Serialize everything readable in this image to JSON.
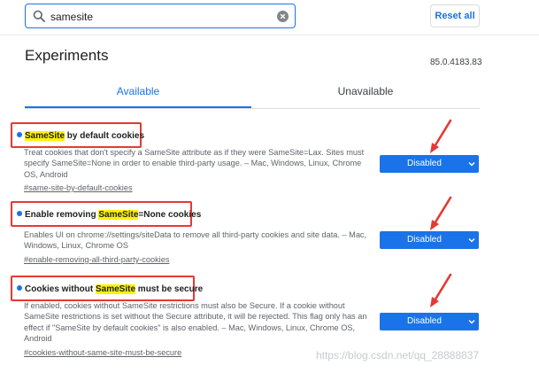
{
  "search": {
    "value": "samesite"
  },
  "reset_label": "Reset all",
  "page_title": "Experiments",
  "version": "85.0.4183.83",
  "tabs": [
    {
      "label": "Available"
    },
    {
      "label": "Unavailable"
    }
  ],
  "experiments": [
    {
      "title_before": "",
      "highlight": "SameSite",
      "title_after": " by default cookies",
      "desc": "Treat cookies that don't specify a SameSite attribute as if they were SameSite=Lax. Sites must specify SameSite=None in order to enable third-party usage. – Mac, Windows, Linux, Chrome OS, Android",
      "link": "#same-site-by-default-cookies",
      "status": "Disabled"
    },
    {
      "title_before": "Enable removing ",
      "highlight": "SameSite",
      "title_after": "=None cookies",
      "desc": "Enables UI on chrome://settings/siteData to remove all third-party cookies and site data. – Mac, Windows, Linux, Chrome OS",
      "link": "#enable-removing-all-third-party-cookies",
      "status": "Disabled"
    },
    {
      "title_before": "Cookies without ",
      "highlight": "SameSite",
      "title_after": " must be secure",
      "desc": "If enabled, cookies without SameSite restrictions must also be Secure. If a cookie without SameSite restrictions is set without the Secure attribute, it will be rejected. This flag only has an effect if \"SameSite by default cookies\" is also enabled. – Mac, Windows, Linux, Chrome OS, Android",
      "link": "#cookies-without-same-site-must-be-secure",
      "status": "Disabled"
    }
  ],
  "watermark": "https://blog.csdn.net/qq_28888837",
  "colors": {
    "accent": "#1a73e8",
    "annotation": "#e53935",
    "highlight": "#fff200"
  }
}
